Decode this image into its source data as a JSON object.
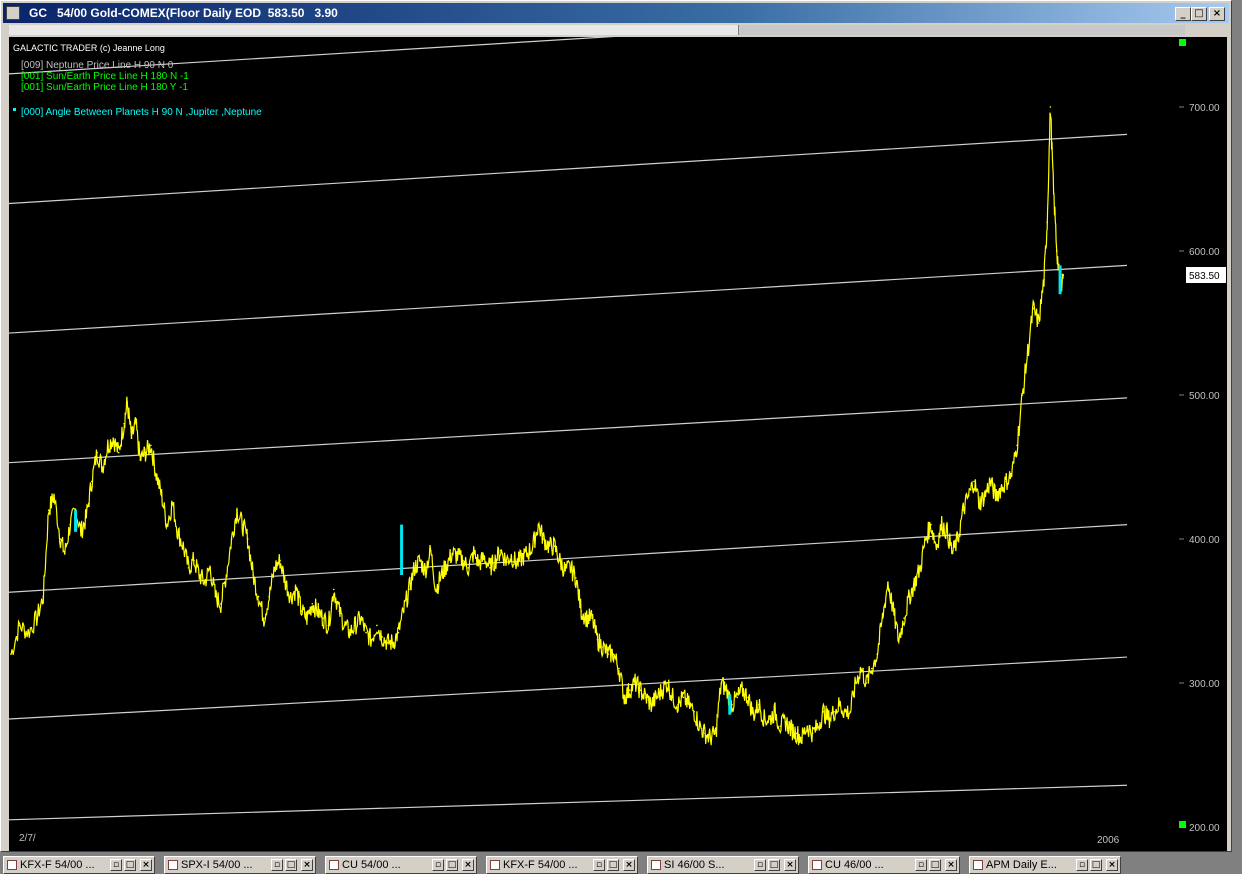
{
  "window": {
    "symbol": "GC",
    "title": "54/00 Gold-COMEX(Floor Daily EOD",
    "last_price": "583.50",
    "change": "3.90",
    "buttons": {
      "minimize": "_",
      "restore": "□",
      "close": "×"
    }
  },
  "chart_data": {
    "type": "line",
    "header": "GALACTIC TRADER (c) Jeanne Long",
    "legend": [
      {
        "text": "[009] Neptune Price Line H 90 N 0",
        "color": "#c0c0c0"
      },
      {
        "text": "[001] Sun/Earth Price Line H 180 N -1",
        "color": "#00ff00"
      },
      {
        "text": "[001] Sun/Earth Price Line H 180 Y -1",
        "color": "#00ff00"
      },
      {
        "text": "[000] Angle Between Planets H 90 N ,Jupiter ,Neptune",
        "color": "#00ffff"
      }
    ],
    "ylim": [
      200,
      730
    ],
    "y_ticks": [
      "700.00",
      "600.00",
      "500.00",
      "400.00",
      "300.00",
      "200.00"
    ],
    "y_tick_values": [
      700,
      600,
      500,
      400,
      300,
      200
    ],
    "current_price_label": "583.50",
    "current_price": 583.5,
    "x_start_label": "2/7/",
    "x_end_label": "2006",
    "colors": {
      "price": "#ffff00",
      "planet_lines": "#d0d0d0",
      "angle_marks": "#00e5ee",
      "background": "#000000",
      "axis_text": "#c0c0c0"
    },
    "price_series": [
      [
        0,
        320
      ],
      [
        0.008,
        340
      ],
      [
        0.016,
        335
      ],
      [
        0.024,
        345
      ],
      [
        0.03,
        360
      ],
      [
        0.035,
        420
      ],
      [
        0.04,
        430
      ],
      [
        0.046,
        400
      ],
      [
        0.05,
        390
      ],
      [
        0.055,
        410
      ],
      [
        0.06,
        420
      ],
      [
        0.065,
        405
      ],
      [
        0.07,
        415
      ],
      [
        0.075,
        440
      ],
      [
        0.08,
        460
      ],
      [
        0.085,
        450
      ],
      [
        0.09,
        465
      ],
      [
        0.095,
        470
      ],
      [
        0.1,
        460
      ],
      [
        0.105,
        480
      ],
      [
        0.108,
        495
      ],
      [
        0.112,
        470
      ],
      [
        0.116,
        480
      ],
      [
        0.12,
        455
      ],
      [
        0.125,
        460
      ],
      [
        0.13,
        465
      ],
      [
        0.135,
        445
      ],
      [
        0.14,
        430
      ],
      [
        0.145,
        410
      ],
      [
        0.15,
        425
      ],
      [
        0.155,
        405
      ],
      [
        0.16,
        395
      ],
      [
        0.165,
        380
      ],
      [
        0.17,
        385
      ],
      [
        0.175,
        375
      ],
      [
        0.18,
        370
      ],
      [
        0.185,
        380
      ],
      [
        0.19,
        360
      ],
      [
        0.195,
        355
      ],
      [
        0.2,
        375
      ],
      [
        0.205,
        400
      ],
      [
        0.21,
        420
      ],
      [
        0.215,
        410
      ],
      [
        0.22,
        400
      ],
      [
        0.225,
        375
      ],
      [
        0.23,
        360
      ],
      [
        0.235,
        345
      ],
      [
        0.24,
        360
      ],
      [
        0.245,
        380
      ],
      [
        0.25,
        385
      ],
      [
        0.255,
        370
      ],
      [
        0.26,
        360
      ],
      [
        0.265,
        365
      ],
      [
        0.27,
        350
      ],
      [
        0.275,
        345
      ],
      [
        0.28,
        355
      ],
      [
        0.285,
        350
      ],
      [
        0.29,
        345
      ],
      [
        0.295,
        340
      ],
      [
        0.3,
        365
      ],
      [
        0.305,
        350
      ],
      [
        0.31,
        340
      ],
      [
        0.315,
        335
      ],
      [
        0.32,
        340
      ],
      [
        0.325,
        345
      ],
      [
        0.33,
        335
      ],
      [
        0.335,
        330
      ],
      [
        0.34,
        340
      ],
      [
        0.345,
        332
      ],
      [
        0.35,
        328
      ],
      [
        0.355,
        328
      ],
      [
        0.36,
        335
      ],
      [
        0.365,
        350
      ],
      [
        0.37,
        365
      ],
      [
        0.375,
        380
      ],
      [
        0.38,
        385
      ],
      [
        0.385,
        378
      ],
      [
        0.39,
        392
      ],
      [
        0.395,
        365
      ],
      [
        0.4,
        375
      ],
      [
        0.405,
        382
      ],
      [
        0.41,
        390
      ],
      [
        0.415,
        388
      ],
      [
        0.42,
        385
      ],
      [
        0.425,
        380
      ],
      [
        0.43,
        390
      ],
      [
        0.435,
        383
      ],
      [
        0.44,
        387
      ],
      [
        0.445,
        380
      ],
      [
        0.45,
        385
      ],
      [
        0.455,
        392
      ],
      [
        0.46,
        385
      ],
      [
        0.465,
        388
      ],
      [
        0.47,
        383
      ],
      [
        0.475,
        387
      ],
      [
        0.48,
        390
      ],
      [
        0.485,
        395
      ],
      [
        0.49,
        410
      ],
      [
        0.495,
        400
      ],
      [
        0.5,
        395
      ],
      [
        0.505,
        395
      ],
      [
        0.51,
        385
      ],
      [
        0.515,
        378
      ],
      [
        0.52,
        380
      ],
      [
        0.525,
        373
      ],
      [
        0.53,
        350
      ],
      [
        0.535,
        345
      ],
      [
        0.54,
        345
      ],
      [
        0.545,
        330
      ],
      [
        0.55,
        325
      ],
      [
        0.555,
        320
      ],
      [
        0.56,
        320
      ],
      [
        0.565,
        310
      ],
      [
        0.57,
        290
      ],
      [
        0.575,
        295
      ],
      [
        0.58,
        300
      ],
      [
        0.585,
        295
      ],
      [
        0.59,
        290
      ],
      [
        0.595,
        285
      ],
      [
        0.6,
        290
      ],
      [
        0.605,
        295
      ],
      [
        0.61,
        300
      ],
      [
        0.615,
        290
      ],
      [
        0.62,
        285
      ],
      [
        0.625,
        290
      ],
      [
        0.63,
        285
      ],
      [
        0.635,
        280
      ],
      [
        0.64,
        270
      ],
      [
        0.645,
        265
      ],
      [
        0.65,
        262
      ],
      [
        0.655,
        265
      ],
      [
        0.66,
        300
      ],
      [
        0.665,
        295
      ],
      [
        0.67,
        285
      ],
      [
        0.675,
        290
      ],
      [
        0.68,
        295
      ],
      [
        0.685,
        290
      ],
      [
        0.69,
        278
      ],
      [
        0.695,
        285
      ],
      [
        0.7,
        275
      ],
      [
        0.705,
        275
      ],
      [
        0.71,
        280
      ],
      [
        0.715,
        270
      ],
      [
        0.72,
        273
      ],
      [
        0.725,
        268
      ],
      [
        0.73,
        265
      ],
      [
        0.735,
        262
      ],
      [
        0.74,
        270
      ],
      [
        0.745,
        265
      ],
      [
        0.75,
        270
      ],
      [
        0.755,
        280
      ],
      [
        0.76,
        275
      ],
      [
        0.765,
        280
      ],
      [
        0.77,
        285
      ],
      [
        0.775,
        280
      ],
      [
        0.78,
        280
      ],
      [
        0.785,
        300
      ],
      [
        0.79,
        310
      ],
      [
        0.795,
        300
      ],
      [
        0.8,
        310
      ],
      [
        0.805,
        320
      ],
      [
        0.81,
        345
      ],
      [
        0.815,
        370
      ],
      [
        0.82,
        350
      ],
      [
        0.825,
        330
      ],
      [
        0.83,
        345
      ],
      [
        0.835,
        360
      ],
      [
        0.84,
        370
      ],
      [
        0.845,
        380
      ],
      [
        0.85,
        400
      ],
      [
        0.855,
        410
      ],
      [
        0.86,
        395
      ],
      [
        0.865,
        410
      ],
      [
        0.87,
        405
      ],
      [
        0.875,
        390
      ],
      [
        0.88,
        400
      ],
      [
        0.885,
        420
      ],
      [
        0.89,
        430
      ],
      [
        0.895,
        440
      ],
      [
        0.9,
        425
      ],
      [
        0.905,
        430
      ],
      [
        0.91,
        440
      ],
      [
        0.915,
        430
      ],
      [
        0.92,
        435
      ],
      [
        0.925,
        440
      ],
      [
        0.93,
        445
      ],
      [
        0.935,
        465
      ],
      [
        0.94,
        500
      ],
      [
        0.945,
        530
      ],
      [
        0.95,
        560
      ],
      [
        0.955,
        550
      ],
      [
        0.96,
        580
      ],
      [
        0.963,
        620
      ],
      [
        0.966,
        700
      ],
      [
        0.969,
        640
      ],
      [
        0.972,
        600
      ],
      [
        0.975,
        575
      ],
      [
        0.978,
        583.5
      ]
    ],
    "angle_marks": [
      {
        "x": 0.06,
        "low": 405,
        "high": 420
      },
      {
        "x": 0.363,
        "low": 375,
        "high": 410
      },
      {
        "x": 0.668,
        "low": 278,
        "high": 292
      },
      {
        "x": 0.975,
        "low": 570,
        "high": 590
      }
    ],
    "planet_lines": [
      {
        "y_start": 205,
        "y_end": 229
      },
      {
        "y_start": 275,
        "y_end": 318
      },
      {
        "y_start": 363,
        "y_end": 410
      },
      {
        "y_start": 453,
        "y_end": 498
      },
      {
        "y_start": 543,
        "y_end": 590
      },
      {
        "y_start": 633,
        "y_end": 681
      },
      {
        "y_start": 723,
        "y_end": 771
      }
    ]
  },
  "taskbar": [
    {
      "label": "KFX-F  54/00 ..."
    },
    {
      "label": "SPX-I  54/00 ..."
    },
    {
      "label": "CU       54/00 ..."
    },
    {
      "label": "KFX-F  54/00 ..."
    },
    {
      "label": "SI        46/00 S..."
    },
    {
      "label": "CU       46/00 ..."
    },
    {
      "label": "APM Daily E..."
    }
  ]
}
